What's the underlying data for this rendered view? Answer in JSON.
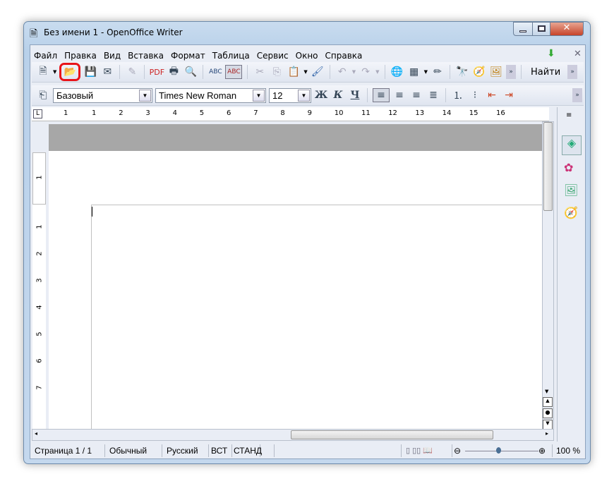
{
  "window": {
    "title": "Без имени 1 - OpenOffice Writer"
  },
  "menu": [
    "Файл",
    "Правка",
    "Вид",
    "Вставка",
    "Формат",
    "Таблица",
    "Сервис",
    "Окно",
    "Справка"
  ],
  "toolbar": {
    "find_label": "Найти",
    "highlighted_button": "open-file",
    "highlight_color": "#e8141a"
  },
  "format": {
    "style": "Базовый",
    "font": "Times New Roman",
    "size": "12",
    "bold": "Ж",
    "italic": "К",
    "underline": "Ч"
  },
  "ruler": {
    "labels": [
      "1",
      "1",
      "2",
      "3",
      "4",
      "5",
      "6",
      "7",
      "8",
      "9",
      "10",
      "11",
      "12",
      "13",
      "14",
      "15",
      "16"
    ]
  },
  "vruler": {
    "labels": [
      "1",
      "1",
      "2",
      "3",
      "4",
      "5",
      "6",
      "7"
    ]
  },
  "status": {
    "page": "Страница 1 / 1",
    "style": "Обычный",
    "language": "Русский",
    "insert_mode": "ВСТ",
    "selection_mode": "СТАНД",
    "zoom": "100 %"
  }
}
